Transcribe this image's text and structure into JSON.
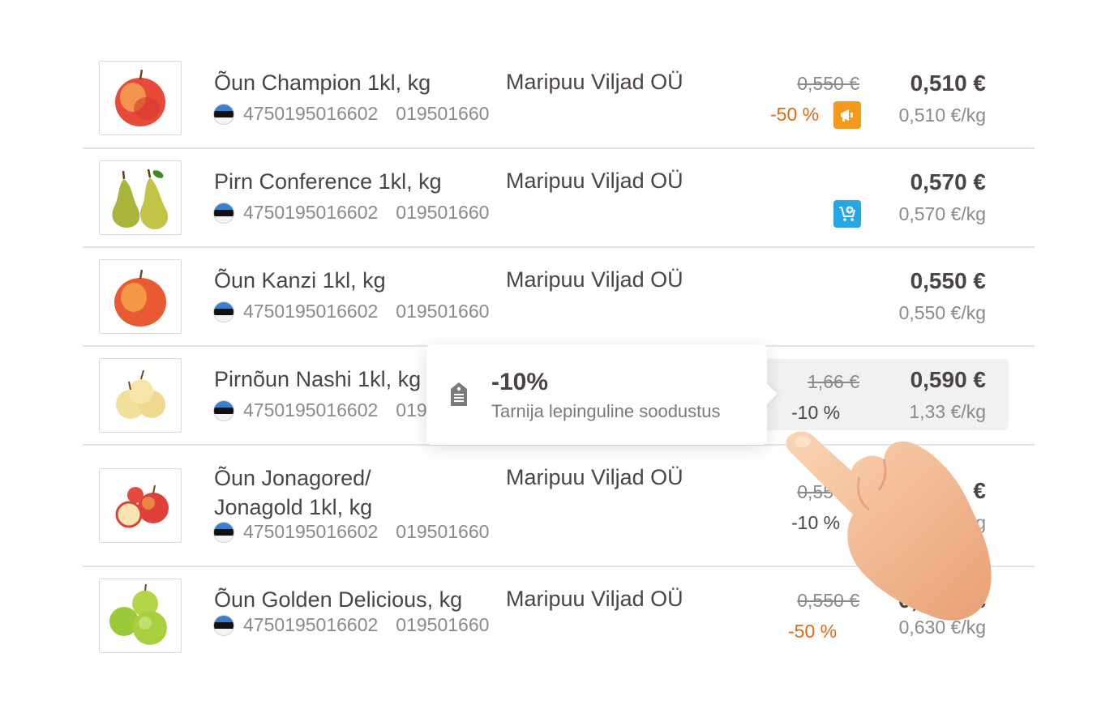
{
  "products": [
    {
      "name": "Õun Champion 1kl, kg",
      "barcode": "4750195016602",
      "code": "019501660",
      "supplier": "Maripuu Viljad OÜ",
      "old_price": "0,550 €",
      "discount": "-50 %",
      "badge": "promo-megaphone-icon",
      "price": "0,510 €",
      "unit_price": "0,510 €/kg",
      "image": "apple-red-icon"
    },
    {
      "name": "Pirn Conference 1kl, kg",
      "barcode": "4750195016602",
      "code": "019501660",
      "supplier": "Maripuu Viljad OÜ",
      "badge": "cart-add-icon",
      "price": "0,570 €",
      "unit_price": "0,570 €/kg",
      "image": "pears-icon"
    },
    {
      "name": "Õun Kanzi 1kl, kg",
      "barcode": "4750195016602",
      "code": "019501660",
      "supplier": "Maripuu Viljad OÜ",
      "price": "0,550 €",
      "unit_price": "0,550 €/kg",
      "image": "apple-red-icon"
    },
    {
      "name": "Pirnõun Nashi 1kl, kg",
      "barcode": "4750195016602",
      "code": "019501660",
      "old_price": "1,66 €",
      "discount": "-10 %",
      "price": "0,590 €",
      "unit_price": "1,33 €/kg",
      "image": "nashi-pears-icon"
    },
    {
      "name_line1": "Õun Jonagored/",
      "name_line2": "Jonagold 1kl, kg",
      "barcode": "4750195016602",
      "code": "019501660",
      "supplier": "Maripuu Viljad OÜ",
      "old_price": "0,550 €",
      "discount": "-10 %",
      "price_partial": "€",
      "unit_partial": "kg",
      "image": "apples-cut-icon"
    },
    {
      "name": "Õun Golden Delicious, kg",
      "barcode": "4750195016602",
      "code": "019501660",
      "supplier": "Maripuu Viljad OÜ",
      "old_price": "0,550 €",
      "discount": "-50 %",
      "price_start": "0,",
      "price_end": "€",
      "unit_price": "0,630 €/kg",
      "image": "apples-green-icon"
    }
  ],
  "tooltip": {
    "title": "-10%",
    "subtitle": "Tarnija lepinguline soodustus"
  },
  "colors": {
    "discount_orange": "#e06a10",
    "promo_badge": "#f39a1e",
    "cart_badge": "#27a6e6",
    "divider": "#e3e3e3"
  }
}
